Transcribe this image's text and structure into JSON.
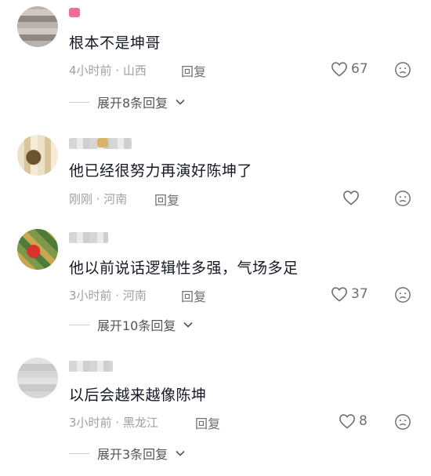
{
  "comments": [
    {
      "text": "根本不是坤哥",
      "time_location": "4小时前 · 山西",
      "reply_label": "回复",
      "likes": "67",
      "expand_label": "展开8条回复"
    },
    {
      "text": "他已经很努力再演好陈坤了",
      "time_location": "刚刚 · 河南",
      "reply_label": "回复",
      "likes": ""
    },
    {
      "text": "他以前说话逻辑性多强，气场多足",
      "time_location": "3小时前 · 河南",
      "reply_label": "回复",
      "likes": "37",
      "expand_label": "展开10条回复"
    },
    {
      "text": "以后会越来越像陈坤",
      "time_location": "3小时前 · 黑龙江",
      "reply_label": "回复",
      "likes": "8",
      "expand_label": "展开3条回复"
    }
  ],
  "icons": {
    "like": "heart-outline-icon",
    "dislike": "frown-face-icon",
    "expand": "chevron-down-icon"
  },
  "colors": {
    "text": "#161823",
    "meta": "#a0a0a5",
    "badge_pink": "#f06a9a",
    "badge_gold": "#d9b36a"
  }
}
